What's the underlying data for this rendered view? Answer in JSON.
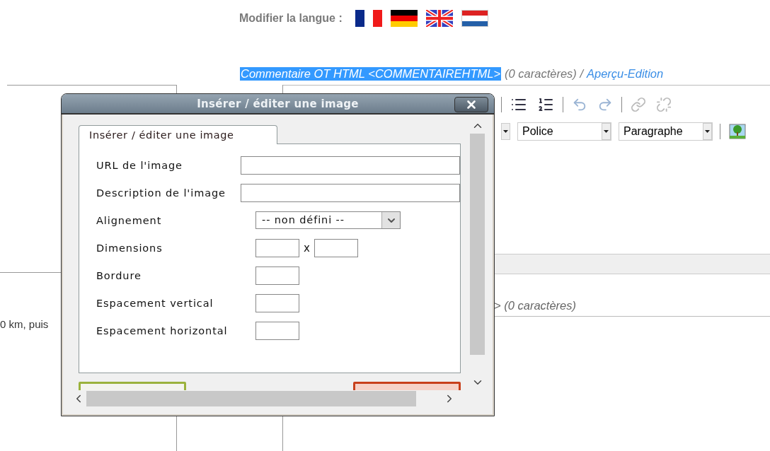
{
  "language_bar": {
    "label": "Modifier la langue :",
    "flags": [
      {
        "kind": "france"
      },
      {
        "kind": "germany"
      },
      {
        "kind": "uk"
      },
      {
        "kind": "netherlands"
      }
    ]
  },
  "field_heading": {
    "title": "Commentaire OT HTML <COMMENTAIREHTML>",
    "count": "(0 caractères) /",
    "link": "Aperçu-Edition"
  },
  "editor": {
    "selects": [
      {
        "value": "Police"
      },
      {
        "value": "Paragraphe"
      }
    ]
  },
  "left_text": "0 km, puis",
  "second_field": {
    "count": "> (0 caractères)"
  },
  "dialog": {
    "title": "Insérer / éditer une image",
    "tabs": [
      {
        "label": "Insérer / éditer une image",
        "selected": true
      }
    ],
    "rows": [
      {
        "label": "URL de l'image",
        "kind": "wide"
      },
      {
        "label": "Description de l'image",
        "kind": "wide"
      },
      {
        "label": "Alignement",
        "kind": "select",
        "value": "-- non défini --"
      },
      {
        "label": "Dimensions",
        "kind": "pair",
        "separator": "x"
      },
      {
        "label": "Bordure",
        "kind": "small"
      },
      {
        "label": "Espacement vertical",
        "kind": "small"
      },
      {
        "label": "Espacement horizontal",
        "kind": "small"
      }
    ],
    "buttons": [
      {
        "kind": "insert"
      },
      {
        "kind": "cancel"
      }
    ]
  }
}
